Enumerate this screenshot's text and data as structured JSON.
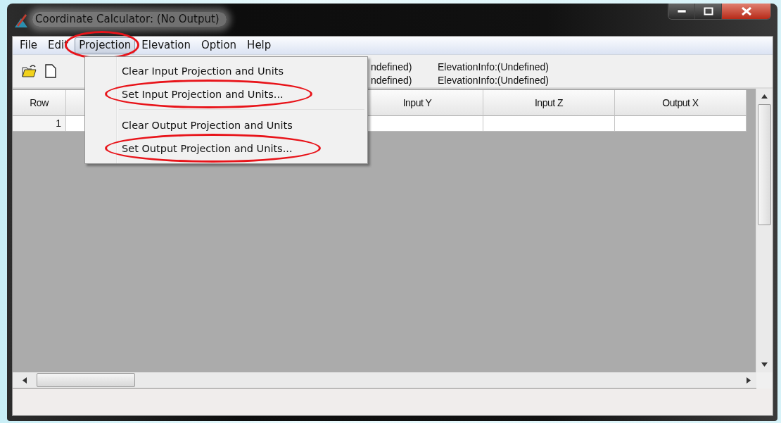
{
  "window": {
    "title": "Coordinate Calculator: (No Output)"
  },
  "menu_bar": [
    {
      "label": "File",
      "selected": false,
      "circled": false
    },
    {
      "label": "Edit",
      "selected": false,
      "circled": false
    },
    {
      "label": "Projection",
      "selected": true,
      "circled": true
    },
    {
      "label": "Elevation",
      "selected": false,
      "circled": false
    },
    {
      "label": "Option",
      "selected": false,
      "circled": false
    },
    {
      "label": "Help",
      "selected": false,
      "circled": false
    }
  ],
  "toolbar": {
    "info_lines": [
      {
        "projection_part": "ndefined)",
        "elevation": "ElevationInfo:(Undefined)"
      },
      {
        "projection_part": "ndefined)",
        "elevation": "ElevationInfo:(Undefined)"
      }
    ]
  },
  "projection_menu": {
    "items": [
      {
        "kind": "item",
        "label": "Clear Input Projection and Units",
        "circled": false
      },
      {
        "kind": "item",
        "label": "Set Input Projection and Units...",
        "circled": true
      },
      {
        "kind": "separator"
      },
      {
        "kind": "item",
        "label": "Clear Output Projection and Units",
        "circled": false
      },
      {
        "kind": "item",
        "label": "Set Output Projection and Units...",
        "circled": true
      }
    ]
  },
  "table": {
    "columns": [
      {
        "label": "Row"
      },
      {
        "label": "Input Y"
      },
      {
        "label": "Input Z"
      },
      {
        "label": "Output X"
      }
    ],
    "rows": [
      {
        "row_number": "1"
      }
    ]
  }
}
